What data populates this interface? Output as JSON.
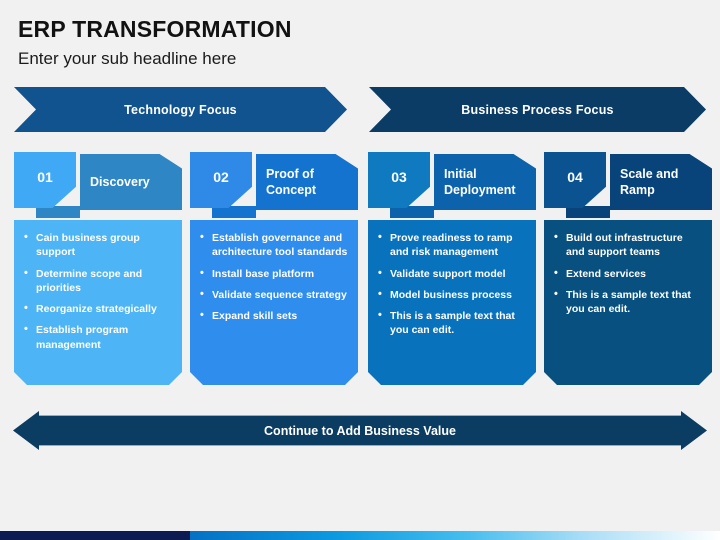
{
  "slide": {
    "title": "ERP TRANSFORMATION",
    "subtitle": "Enter your sub headline here",
    "background_color": "#f1f1f1"
  },
  "banners": [
    {
      "label": "Technology Focus",
      "color": "#11538f"
    },
    {
      "label": "Business Process Focus",
      "color": "#0a3c66"
    }
  ],
  "columns": [
    {
      "number": "01",
      "title": "Discovery",
      "number_color": "#3fa9f5",
      "title_color": "#2f86c5",
      "body_color": "#4db4f5",
      "bullets": [
        "Cain business group support",
        "Determine scope and priorities",
        "Reorganize strategically",
        "Establish program management"
      ]
    },
    {
      "number": "02",
      "title": "Proof of Concept",
      "number_color": "#2e8ae6",
      "title_color": "#1473ce",
      "body_color": "#2f8ded",
      "bullets": [
        "Establish governance and architecture tool standards",
        "Install base platform",
        "Validate sequence strategy",
        "Expand skill sets"
      ]
    },
    {
      "number": "03",
      "title": "Initial Deployment",
      "number_color": "#0f7ac0",
      "title_color": "#0d63ab",
      "body_color": "#0872bd",
      "bullets": [
        "Prove readiness to ramp and risk management",
        "Validate support model",
        "Model business process",
        "This is a sample text that you can edit."
      ]
    },
    {
      "number": "04",
      "title": "Scale and Ramp",
      "number_color": "#0b5390",
      "title_color": "#08437a",
      "body_color": "#07507f",
      "bullets": [
        "Build out infrastructure and support teams",
        "Extend services",
        "This is a sample text that you can edit."
      ]
    }
  ],
  "bottom_banner": {
    "label": "Continue to Add Business Value",
    "color": "#0b3c62"
  },
  "footer": {
    "dark_color": "#0c1c52",
    "gradient_start": "#0571c4",
    "gradient_end": "#ffffff"
  }
}
